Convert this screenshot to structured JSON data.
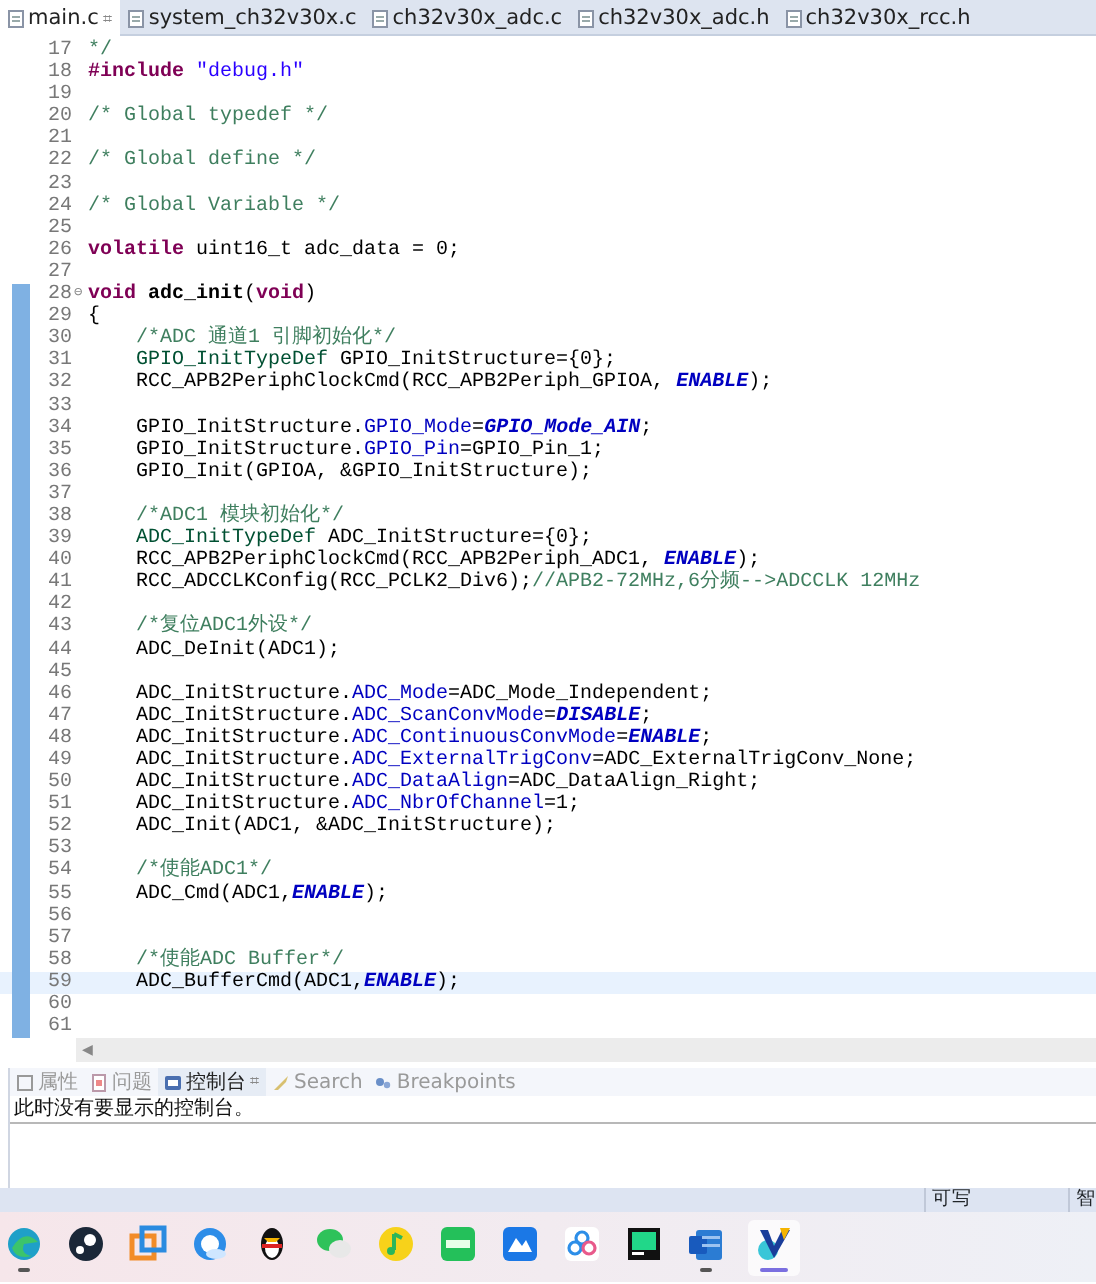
{
  "editor_tabs": [
    {
      "label": "main.c",
      "selected": true,
      "close": "⌗"
    },
    {
      "label": "system_ch32v30x.c",
      "selected": false
    },
    {
      "label": "ch32v30x_adc.c",
      "selected": false
    },
    {
      "label": "ch32v30x_adc.h",
      "selected": false
    },
    {
      "label": "ch32v30x_rcc.h",
      "selected": false
    }
  ],
  "code_lines": [
    {
      "number": "17",
      "current": false,
      "scope": false,
      "segments": [
        {
          "kind": "comment",
          "text": "*/"
        }
      ]
    },
    {
      "number": "18",
      "current": false,
      "scope": false,
      "segments": [
        {
          "kind": "keyword",
          "text": "#include"
        },
        {
          "kind": "string",
          "text": " \"debug.h\""
        }
      ]
    },
    {
      "number": "19",
      "current": false,
      "scope": false
    },
    {
      "number": "20",
      "current": false,
      "scope": false,
      "segments": [
        {
          "kind": "comment",
          "text": "/* Global typedef */"
        }
      ]
    },
    {
      "number": "21",
      "current": false,
      "scope": false
    },
    {
      "number": "22",
      "current": false,
      "scope": false,
      "segments": [
        {
          "kind": "comment",
          "text": "/* Global define */"
        }
      ]
    },
    {
      "number": "23",
      "current": false,
      "scope": false
    },
    {
      "number": "24",
      "current": false,
      "scope": false,
      "segments": [
        {
          "kind": "comment",
          "text": "/* Global Variable */"
        }
      ]
    },
    {
      "number": "25",
      "current": false,
      "scope": false
    },
    {
      "number": "26",
      "current": false,
      "scope": false,
      "segments": [
        {
          "kind": "keyword",
          "text": "volatile"
        },
        {
          "kind": "plain",
          "text": " uint16_t adc_data = 0;"
        }
      ]
    },
    {
      "number": "27",
      "current": false,
      "scope": false
    },
    {
      "number": "28",
      "current": false,
      "scope": true,
      "fold": "⊖",
      "segments": [
        {
          "kind": "keyword",
          "text": "void"
        },
        {
          "kind": "function",
          "text": " adc_init"
        },
        {
          "kind": "plain",
          "text": "("
        },
        {
          "kind": "keyword",
          "text": "void"
        },
        {
          "kind": "plain",
          "text": ")"
        }
      ]
    },
    {
      "number": "29",
      "current": false,
      "scope": true,
      "segments": [
        {
          "kind": "plain",
          "text": "{"
        }
      ]
    },
    {
      "number": "30",
      "current": false,
      "scope": true,
      "segments": [
        {
          "kind": "comment",
          "text": "    /*ADC 通道1 引脚初始化*/"
        }
      ]
    },
    {
      "number": "31",
      "current": false,
      "scope": true,
      "segments": [
        {
          "kind": "type",
          "text": "    GPIO_InitTypeDef"
        },
        {
          "kind": "plain",
          "text": " GPIO_InitStructure={0};"
        }
      ]
    },
    {
      "number": "32",
      "current": false,
      "scope": true,
      "segments": [
        {
          "kind": "plain",
          "text": "    RCC_APB2PeriphClockCmd(RCC_APB2Periph_GPIOA, "
        },
        {
          "kind": "constant",
          "text": "ENABLE"
        },
        {
          "kind": "plain",
          "text": ");"
        }
      ]
    },
    {
      "number": "33",
      "current": false,
      "scope": true
    },
    {
      "number": "34",
      "current": false,
      "scope": true,
      "segments": [
        {
          "kind": "plain",
          "text": "    GPIO_InitStructure."
        },
        {
          "kind": "field",
          "text": "GPIO_Mode"
        },
        {
          "kind": "plain",
          "text": "="
        },
        {
          "kind": "constant",
          "text": "GPIO_Mode_AIN"
        },
        {
          "kind": "plain",
          "text": ";"
        }
      ]
    },
    {
      "number": "35",
      "current": false,
      "scope": true,
      "segments": [
        {
          "kind": "plain",
          "text": "    GPIO_InitStructure."
        },
        {
          "kind": "field",
          "text": "GPIO_Pin"
        },
        {
          "kind": "plain",
          "text": "=GPIO_Pin_1;"
        }
      ]
    },
    {
      "number": "36",
      "current": false,
      "scope": true,
      "segments": [
        {
          "kind": "plain",
          "text": "    GPIO_Init(GPIOA, &GPIO_InitStructure);"
        }
      ]
    },
    {
      "number": "37",
      "current": false,
      "scope": true
    },
    {
      "number": "38",
      "current": false,
      "scope": true,
      "segments": [
        {
          "kind": "comment",
          "text": "    /*ADC1 模块初始化*/"
        }
      ]
    },
    {
      "number": "39",
      "current": false,
      "scope": true,
      "segments": [
        {
          "kind": "type",
          "text": "    ADC_InitTypeDef"
        },
        {
          "kind": "plain",
          "text": " ADC_InitStructure={0};"
        }
      ]
    },
    {
      "number": "40",
      "current": false,
      "scope": true,
      "segments": [
        {
          "kind": "plain",
          "text": "    RCC_APB2PeriphClockCmd(RCC_APB2Periph_ADC1, "
        },
        {
          "kind": "constant",
          "text": "ENABLE"
        },
        {
          "kind": "plain",
          "text": ");"
        }
      ]
    },
    {
      "number": "41",
      "current": false,
      "scope": true,
      "segments": [
        {
          "kind": "plain",
          "text": "    RCC_ADCCLKConfig(RCC_PCLK2_Div6);"
        },
        {
          "kind": "comment",
          "text": "//APB2-72MHz,6分频-->ADCCLK 12MHz"
        }
      ]
    },
    {
      "number": "42",
      "current": false,
      "scope": true
    },
    {
      "number": "43",
      "current": false,
      "scope": true,
      "segments": [
        {
          "kind": "comment",
          "text": "    /*复位ADC1外设*/"
        }
      ]
    },
    {
      "number": "44",
      "current": false,
      "scope": true,
      "segments": [
        {
          "kind": "plain",
          "text": "    ADC_DeInit(ADC1);"
        }
      ]
    },
    {
      "number": "45",
      "current": false,
      "scope": true
    },
    {
      "number": "46",
      "current": false,
      "scope": true,
      "segments": [
        {
          "kind": "plain",
          "text": "    ADC_InitStructure."
        },
        {
          "kind": "field",
          "text": "ADC_Mode"
        },
        {
          "kind": "plain",
          "text": "=ADC_Mode_Independent;"
        }
      ]
    },
    {
      "number": "47",
      "current": false,
      "scope": true,
      "segments": [
        {
          "kind": "plain",
          "text": "    ADC_InitStructure."
        },
        {
          "kind": "field",
          "text": "ADC_ScanConvMode"
        },
        {
          "kind": "plain",
          "text": "="
        },
        {
          "kind": "constant",
          "text": "DISABLE"
        },
        {
          "kind": "plain",
          "text": ";"
        }
      ]
    },
    {
      "number": "48",
      "current": false,
      "scope": true,
      "segments": [
        {
          "kind": "plain",
          "text": "    ADC_InitStructure."
        },
        {
          "kind": "field",
          "text": "ADC_ContinuousConvMode"
        },
        {
          "kind": "plain",
          "text": "="
        },
        {
          "kind": "constant",
          "text": "ENABLE"
        },
        {
          "kind": "plain",
          "text": ";"
        }
      ]
    },
    {
      "number": "49",
      "current": false,
      "scope": true,
      "segments": [
        {
          "kind": "plain",
          "text": "    ADC_InitStructure."
        },
        {
          "kind": "field",
          "text": "ADC_ExternalTrigConv"
        },
        {
          "kind": "plain",
          "text": "=ADC_ExternalTrigConv_None;"
        }
      ]
    },
    {
      "number": "50",
      "current": false,
      "scope": true,
      "segments": [
        {
          "kind": "plain",
          "text": "    ADC_InitStructure."
        },
        {
          "kind": "field",
          "text": "ADC_DataAlign"
        },
        {
          "kind": "plain",
          "text": "=ADC_DataAlign_Right;"
        }
      ]
    },
    {
      "number": "51",
      "current": false,
      "scope": true,
      "segments": [
        {
          "kind": "plain",
          "text": "    ADC_InitStructure."
        },
        {
          "kind": "field",
          "text": "ADC_NbrOfChannel"
        },
        {
          "kind": "plain",
          "text": "=1;"
        }
      ]
    },
    {
      "number": "52",
      "current": false,
      "scope": true,
      "segments": [
        {
          "kind": "plain",
          "text": "    ADC_Init(ADC1, &ADC_InitStructure);"
        }
      ]
    },
    {
      "number": "53",
      "current": false,
      "scope": true
    },
    {
      "number": "54",
      "current": false,
      "scope": true,
      "segments": [
        {
          "kind": "comment",
          "text": "    /*使能ADC1*/"
        }
      ]
    },
    {
      "number": "55",
      "current": false,
      "scope": true,
      "segments": [
        {
          "kind": "plain",
          "text": "    ADC_Cmd(ADC1,"
        },
        {
          "kind": "constant",
          "text": "ENABLE"
        },
        {
          "kind": "plain",
          "text": ");"
        }
      ]
    },
    {
      "number": "56",
      "current": false,
      "scope": true
    },
    {
      "number": "57",
      "current": false,
      "scope": true
    },
    {
      "number": "58",
      "current": false,
      "scope": true,
      "segments": [
        {
          "kind": "comment",
          "text": "    /*使能ADC Buffer*/"
        }
      ]
    },
    {
      "number": "59",
      "current": true,
      "scope": true,
      "segments": [
        {
          "kind": "plain",
          "text": "    ADC_BufferCmd(ADC1,"
        },
        {
          "kind": "constant",
          "text": "ENABLE"
        },
        {
          "kind": "plain",
          "text": ");"
        }
      ]
    },
    {
      "number": "60",
      "current": false,
      "scope": true
    },
    {
      "number": "61",
      "current": false,
      "scope": true
    }
  ],
  "scroll_left": "◀",
  "panel_tabs": [
    {
      "label": "属性",
      "selected": false
    },
    {
      "label": "问题",
      "selected": false
    },
    {
      "label": "控制台",
      "selected": true,
      "close": "⌗"
    },
    {
      "label": "Search",
      "selected": false
    },
    {
      "label": "Breakpoints",
      "selected": false
    }
  ],
  "console_message": "此时没有要显示的控制台。",
  "status_bar": [
    "可写",
    "智"
  ],
  "taskbar": [
    {
      "running": true,
      "active": false
    },
    {
      "running": false,
      "active": false
    },
    {
      "running": false,
      "active": false
    },
    {
      "running": false,
      "active": false
    },
    {
      "running": false,
      "active": false
    },
    {
      "running": false,
      "active": false
    },
    {
      "running": false,
      "active": false
    },
    {
      "running": false,
      "active": false
    },
    {
      "running": false,
      "active": false
    },
    {
      "running": false,
      "active": false
    },
    {
      "running": false,
      "active": false
    },
    {
      "running": true,
      "active": false
    },
    {
      "running": false,
      "active": true
    }
  ]
}
